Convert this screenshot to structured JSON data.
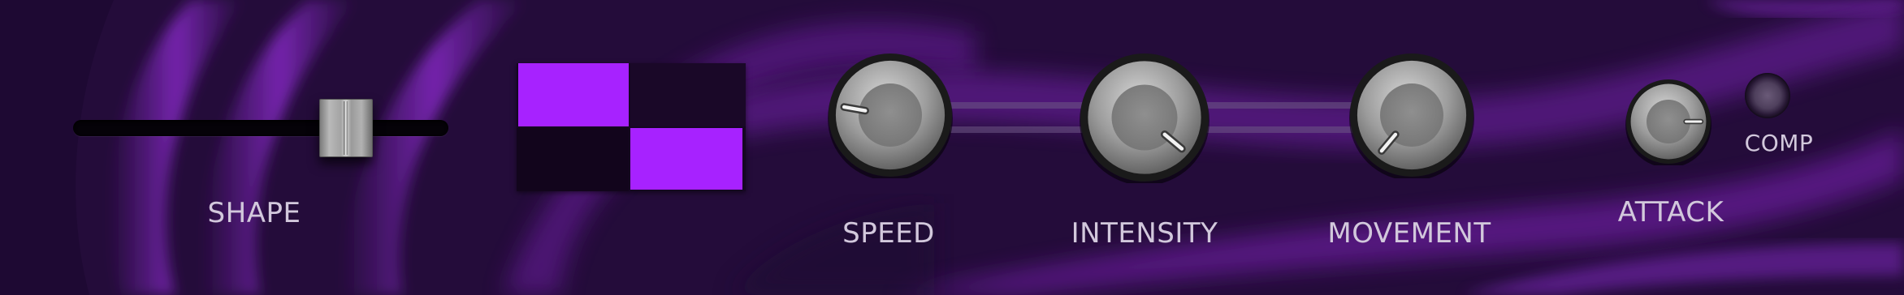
{
  "colors": {
    "background": "#230c38",
    "accent": "#a722ff",
    "label": "#d2c8dc"
  },
  "shape": {
    "label": "SHAPE",
    "value": 0.72
  },
  "shape_display": {
    "icon": "square-wave-display"
  },
  "knobs": [
    {
      "id": "speed",
      "label": "SPEED",
      "angle_deg": -80
    },
    {
      "id": "intensity",
      "label": "INTENSITY",
      "angle_deg": 130
    },
    {
      "id": "movement",
      "label": "MOVEMENT",
      "angle_deg": -140
    },
    {
      "id": "attack",
      "label": "ATTACK",
      "angle_deg": 90
    }
  ],
  "comp": {
    "label": "COMP",
    "active": false
  }
}
